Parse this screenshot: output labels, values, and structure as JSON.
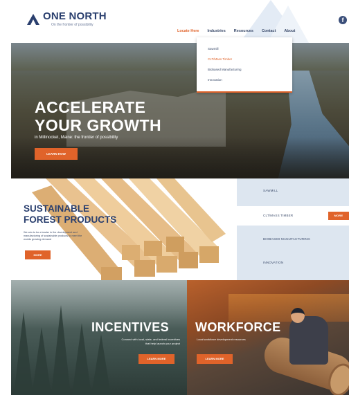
{
  "brand": {
    "name": "ONE NORTH",
    "tagline": "On the frontier of possibility",
    "accent": "#e0632a",
    "primary": "#2a3f6e"
  },
  "nav": {
    "items": [
      "Locate Here",
      "Industries",
      "Resources",
      "Contact",
      "About"
    ],
    "active_index": 0,
    "social_icon": "facebook-icon"
  },
  "dropdown": {
    "items": [
      "Sawmill",
      "CLT/Mass Timber",
      "Biobased Manufacturing",
      "Innovation"
    ],
    "active_index": 1
  },
  "hero": {
    "title_line1": "ACCELERATE",
    "title_line2": "YOUR GROWTH",
    "subtitle": "in Millinocket, Maine: the frontier of possibility",
    "button": "LEARN HOW"
  },
  "forest": {
    "title_line1": "SUSTAINABLE",
    "title_line2": "FOREST PRODUCTS",
    "description": "We aim to be a leader in the development and manufacturing of sustainable products to meet the worlds growing demand",
    "button": "MORE"
  },
  "side_menu": {
    "items": [
      "SAWMILL",
      "CLT/MASS TIMBER",
      "BIOBASED MANUFACTURING",
      "INNOVATION"
    ],
    "selected_index": 1,
    "more_label": "MORE"
  },
  "incentives": {
    "title": "INCENTIVES",
    "subtitle_line1": "Connect with local, state, and federal incentives",
    "subtitle_line2": "that help launch your project",
    "button": "LEARN MORE"
  },
  "workforce": {
    "title": "WORKFORCE",
    "subtitle": "Local workforce development resources",
    "button": "LEARN MORE"
  }
}
